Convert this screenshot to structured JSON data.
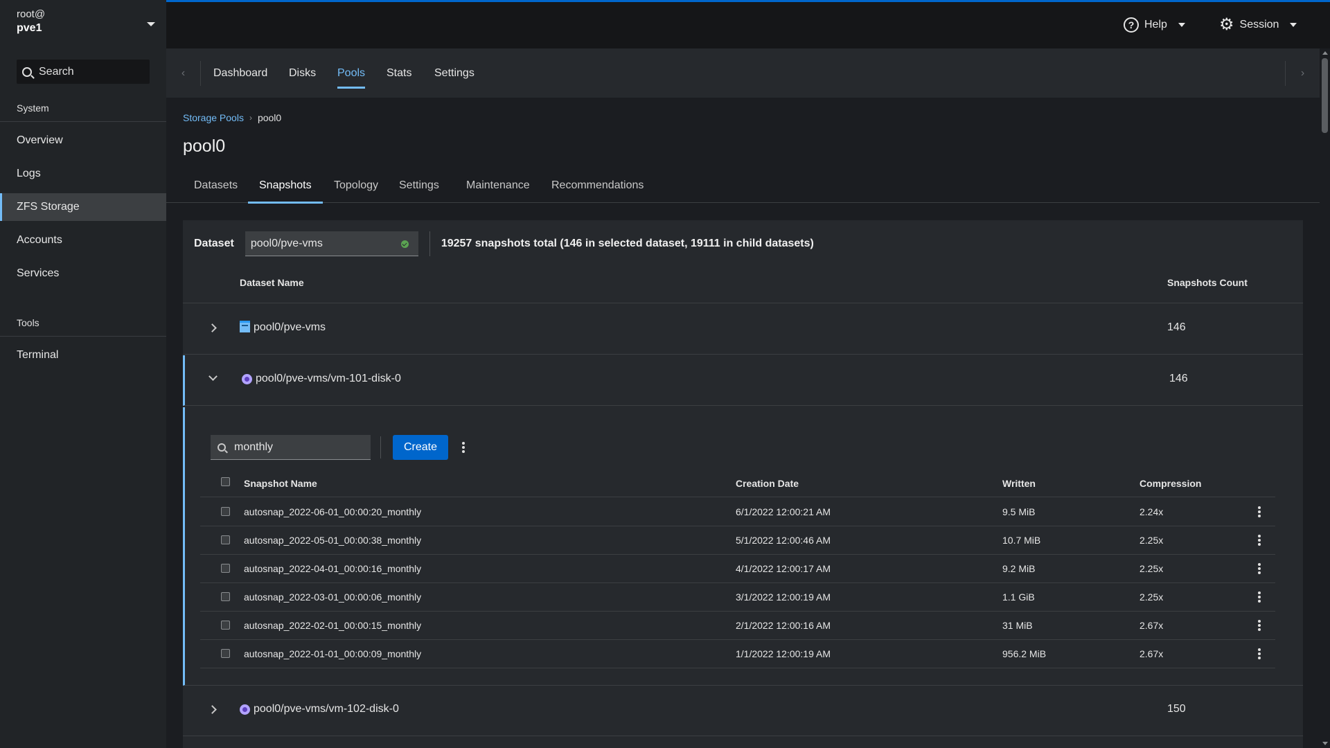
{
  "sidebar": {
    "user": "root@",
    "host": "pve1",
    "search_label": "Search",
    "sections": [
      {
        "label": "System",
        "items": [
          "Overview",
          "Logs",
          "ZFS Storage",
          "Accounts",
          "Services"
        ]
      },
      {
        "label": "Tools",
        "items": [
          "Terminal"
        ]
      }
    ],
    "active_item": "ZFS Storage"
  },
  "topbar": {
    "help_label": "Help",
    "session_label": "Session",
    "accent_color": "#0066cc"
  },
  "module_tabs": [
    "Dashboard",
    "Disks",
    "Pools",
    "Stats",
    "Settings"
  ],
  "module_active": "Pools",
  "breadcrumb": {
    "parent": "Storage Pools",
    "current": "pool0"
  },
  "page_title": "pool0",
  "sub_tabs": [
    "Datasets",
    "Snapshots",
    "Topology",
    "Settings",
    "Maintenance",
    "Recommendations"
  ],
  "sub_tab_active": "Snapshots",
  "dataset_filter": {
    "label": "Dataset",
    "value": "pool0/pve-vms",
    "summary": "19257 snapshots total (146 in selected dataset, 19111 in child datasets)"
  },
  "dataset_table": {
    "headers": {
      "name": "Dataset Name",
      "count": "Snapshots Count"
    },
    "rows": [
      {
        "name": "pool0/pve-vms",
        "type": "filesystem-icon",
        "count": "146",
        "expanded": false
      },
      {
        "name": "pool0/pve-vms/vm-101-disk-0",
        "type": "volume-icon",
        "count": "146",
        "expanded": true
      },
      {
        "name": "pool0/pve-vms/vm-102-disk-0",
        "type": "volume-icon",
        "count": "150",
        "expanded": false
      }
    ]
  },
  "snapshots": {
    "search_value": "monthly",
    "create_label": "Create",
    "headers": {
      "name": "Snapshot Name",
      "date": "Creation Date",
      "written": "Written",
      "compression": "Compression"
    },
    "rows": [
      {
        "name": "autosnap_2022-06-01_00:00:20_monthly",
        "date": "6/1/2022 12:00:21 AM",
        "written": "9.5 MiB",
        "compression": "2.24x"
      },
      {
        "name": "autosnap_2022-05-01_00:00:38_monthly",
        "date": "5/1/2022 12:00:46 AM",
        "written": "10.7 MiB",
        "compression": "2.25x"
      },
      {
        "name": "autosnap_2022-04-01_00:00:16_monthly",
        "date": "4/1/2022 12:00:17 AM",
        "written": "9.2 MiB",
        "compression": "2.25x"
      },
      {
        "name": "autosnap_2022-03-01_00:00:06_monthly",
        "date": "3/1/2022 12:00:19 AM",
        "written": "1.1 GiB",
        "compression": "2.25x"
      },
      {
        "name": "autosnap_2022-02-01_00:00:15_monthly",
        "date": "2/1/2022 12:00:16 AM",
        "written": "31 MiB",
        "compression": "2.67x"
      },
      {
        "name": "autosnap_2022-01-01_00:00:09_monthly",
        "date": "1/1/2022 12:00:19 AM",
        "written": "956.2 MiB",
        "compression": "2.67x"
      }
    ]
  }
}
